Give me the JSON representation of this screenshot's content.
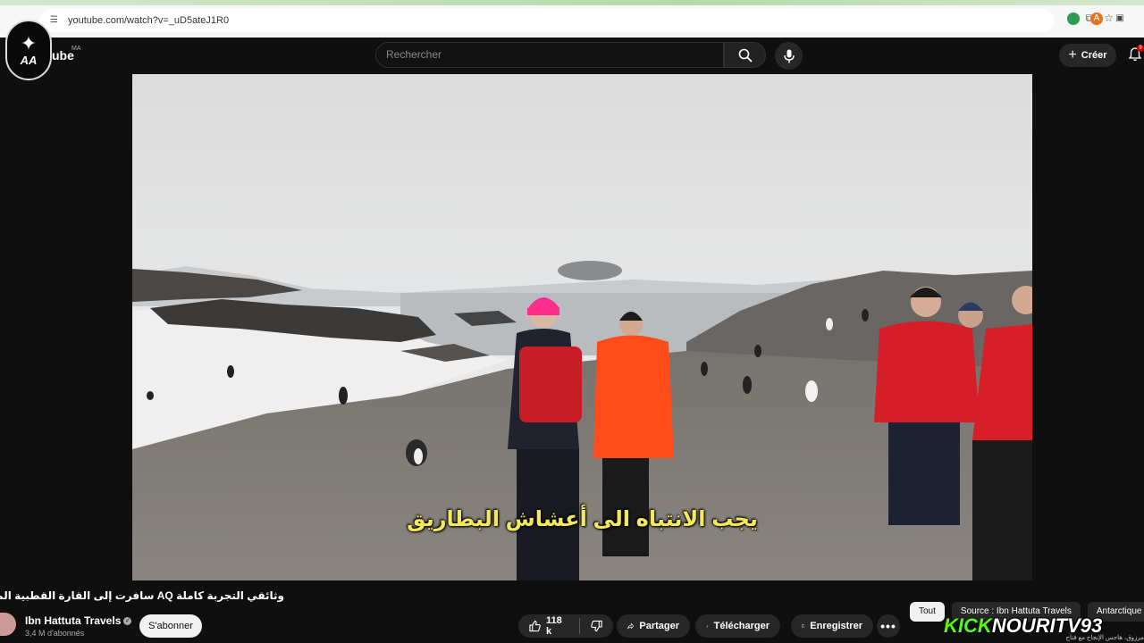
{
  "browser": {
    "url": "youtube.com/watch?v=_uD5ateJ1R0",
    "extension_badge": "6"
  },
  "header": {
    "logo_word": "ube",
    "region": "MA",
    "badge_text": "AA",
    "search_placeholder": "Rechercher",
    "create_label": "Créer",
    "notifications_count": "9"
  },
  "video": {
    "subtitle": "يجب الانتباه الى أعشاش البطاريق",
    "title": "وثائقي التجربة كاملة AQ سافرت إلى القارة القطبية المتجمدة أنتاركتيكا"
  },
  "channel": {
    "name": "Ibn Hattuta Travels",
    "subscribers": "3,4 M d'abonnés",
    "subscribe_label": "S'abonner"
  },
  "actions": {
    "likes": "118 k",
    "share_label": "Partager",
    "download_label": "Télécharger",
    "save_label": "Enregistrer"
  },
  "chips": [
    "Tout",
    "Source : Ibn Hattuta Travels",
    "Antarctique"
  ],
  "watermark": {
    "kick": "KICK",
    "name": "NOURITV93",
    "ticker": "مرزوق، هاجس الإنجاح مع فتاح"
  },
  "colors": {
    "background": "#0f0f0f",
    "subtitle": "#f5e85a",
    "kick_green": "#53fc18",
    "pill": "#272727"
  }
}
